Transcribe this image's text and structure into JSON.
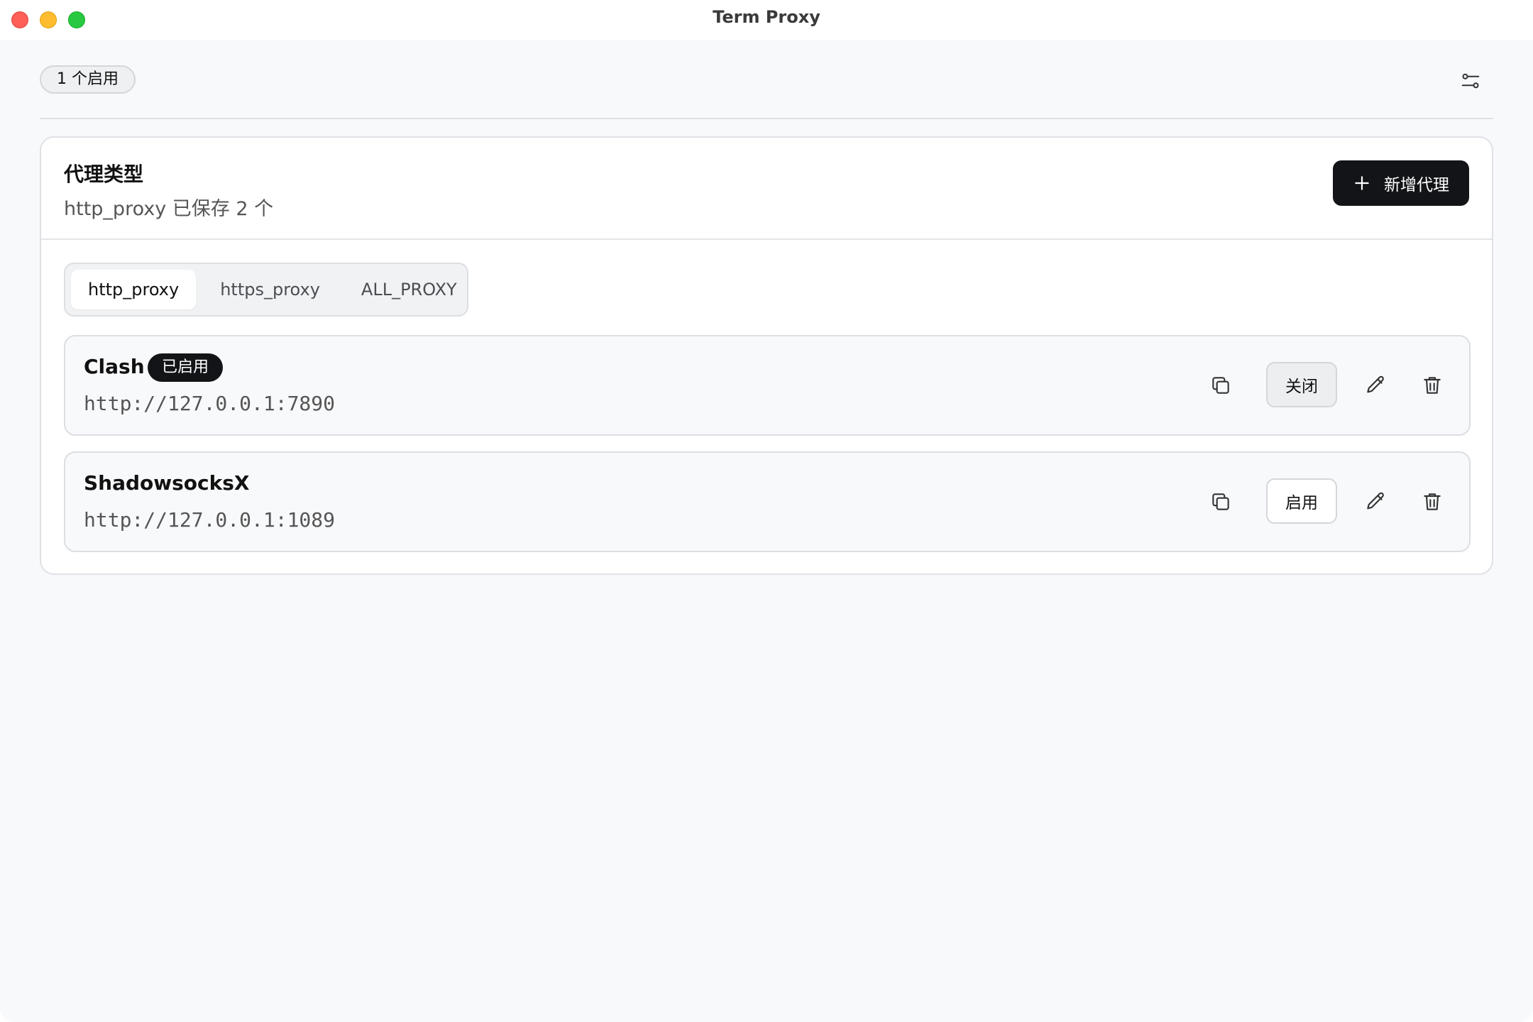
{
  "window": {
    "title": "Term Proxy"
  },
  "status": {
    "label": "1 个启用"
  },
  "card": {
    "title": "代理类型",
    "subtitle": "http_proxy 已保存 2 个",
    "add_label": "新增代理"
  },
  "tabs": [
    {
      "label": "http_proxy",
      "active": true
    },
    {
      "label": "https_proxy",
      "active": false
    },
    {
      "label": "ALL_PROXY",
      "active": false
    }
  ],
  "proxies": [
    {
      "name": "Clash",
      "badge": "已启用",
      "url": "http://127.0.0.1:7890",
      "toggle_label": "关闭"
    },
    {
      "name": "ShadowsocksX",
      "url": "http://127.0.0.1:1089",
      "toggle_label": "启用"
    }
  ],
  "icons": {
    "settings": "sliders-icon",
    "add": "plus-icon",
    "copy": "copy-icon",
    "edit": "pencil-icon",
    "delete": "trash-icon"
  },
  "colors": {
    "primary": "#121417",
    "background": "#f8f9fb",
    "traffic_close": "#fe5f57",
    "traffic_min": "#febc2e",
    "traffic_max": "#28c840"
  }
}
